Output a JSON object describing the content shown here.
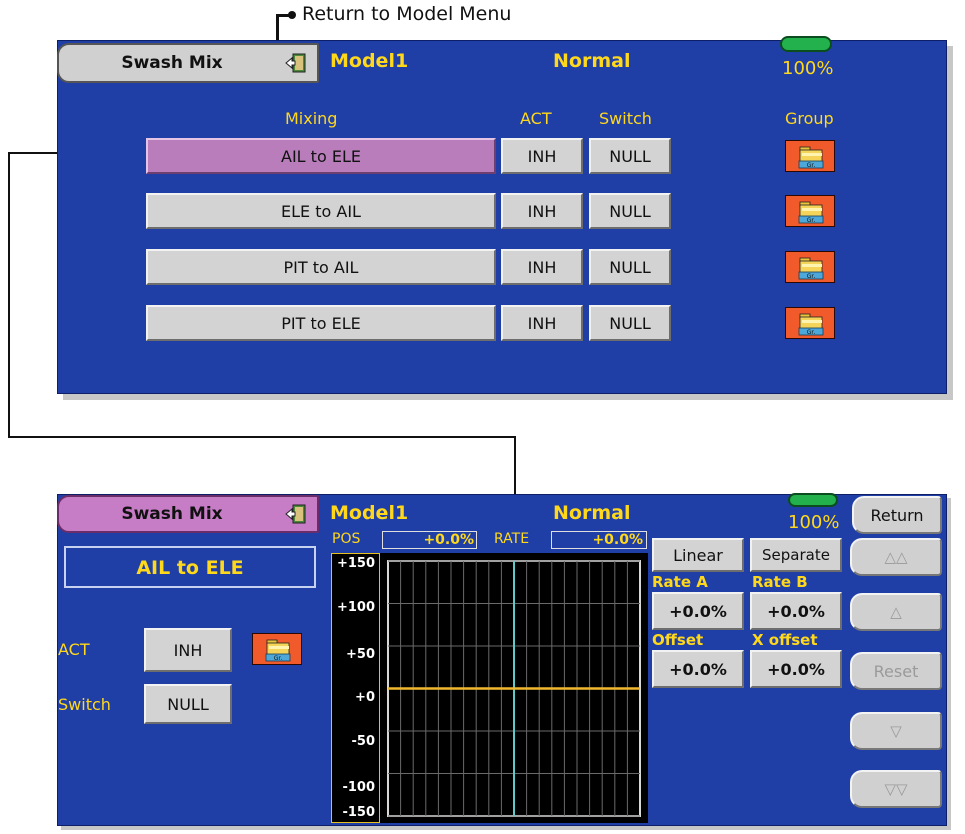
{
  "annotation": {
    "return_callout": "Return to Model Menu"
  },
  "top": {
    "title_tab": "Swash Mix",
    "model": "Model1",
    "condition": "Normal",
    "battery": "100%",
    "headers": {
      "mixing": "Mixing",
      "act": "ACT",
      "switch": "Switch",
      "group": "Group"
    },
    "rows": [
      {
        "mix": "AIL to ELE",
        "act": "INH",
        "sw": "NULL",
        "group_icon": "group-folder-icon"
      },
      {
        "mix": "ELE to AIL",
        "act": "INH",
        "sw": "NULL",
        "group_icon": "group-folder-icon"
      },
      {
        "mix": "PIT to AIL",
        "act": "INH",
        "sw": "NULL",
        "group_icon": "group-folder-icon"
      },
      {
        "mix": "PIT to ELE",
        "act": "INH",
        "sw": "NULL",
        "group_icon": "group-folder-icon"
      }
    ]
  },
  "bottom": {
    "title_tab": "Swash Mix",
    "model": "Model1",
    "condition": "Normal",
    "battery": "100%",
    "mix_name": "AIL to ELE",
    "act_label": "ACT",
    "act_value": "INH",
    "switch_label": "Switch",
    "switch_value": "NULL",
    "pos_label": "POS",
    "pos_value": "+0.0%",
    "rate_label": "RATE",
    "rate_value": "+0.0%",
    "curve_type": "Linear",
    "mode": "Separate",
    "rate_a_label": "Rate A",
    "rate_a": "+0.0%",
    "rate_b_label": "Rate B",
    "rate_b": "+0.0%",
    "offset_label": "Offset",
    "offset": "+0.0%",
    "x_offset_label": "X offset",
    "x_offset": "+0.0%",
    "return_button": "Return",
    "up_fast": "△△",
    "up": "△",
    "reset": "Reset",
    "down": "▽",
    "down_fast": "▽▽",
    "y_ticks": [
      "+150",
      "+100",
      "+50",
      "+0",
      "-50",
      "-100",
      "-150"
    ]
  },
  "colors": {
    "panel": "#1f3fa6",
    "accent": "#ffd81c",
    "selected": "#b87dba",
    "group": "#f15a2b",
    "curve": "#f1b82d",
    "center_line": "#5ec9c9"
  },
  "chart_data": {
    "type": "line",
    "series": [
      {
        "x": [
          -100,
          100
        ],
        "values": [
          0,
          0
        ]
      }
    ],
    "xlim": [
      -100,
      100
    ],
    "ylim": [
      -150,
      150
    ],
    "yticks": [
      150,
      100,
      50,
      0,
      -50,
      -100,
      -150
    ],
    "grid": true
  }
}
